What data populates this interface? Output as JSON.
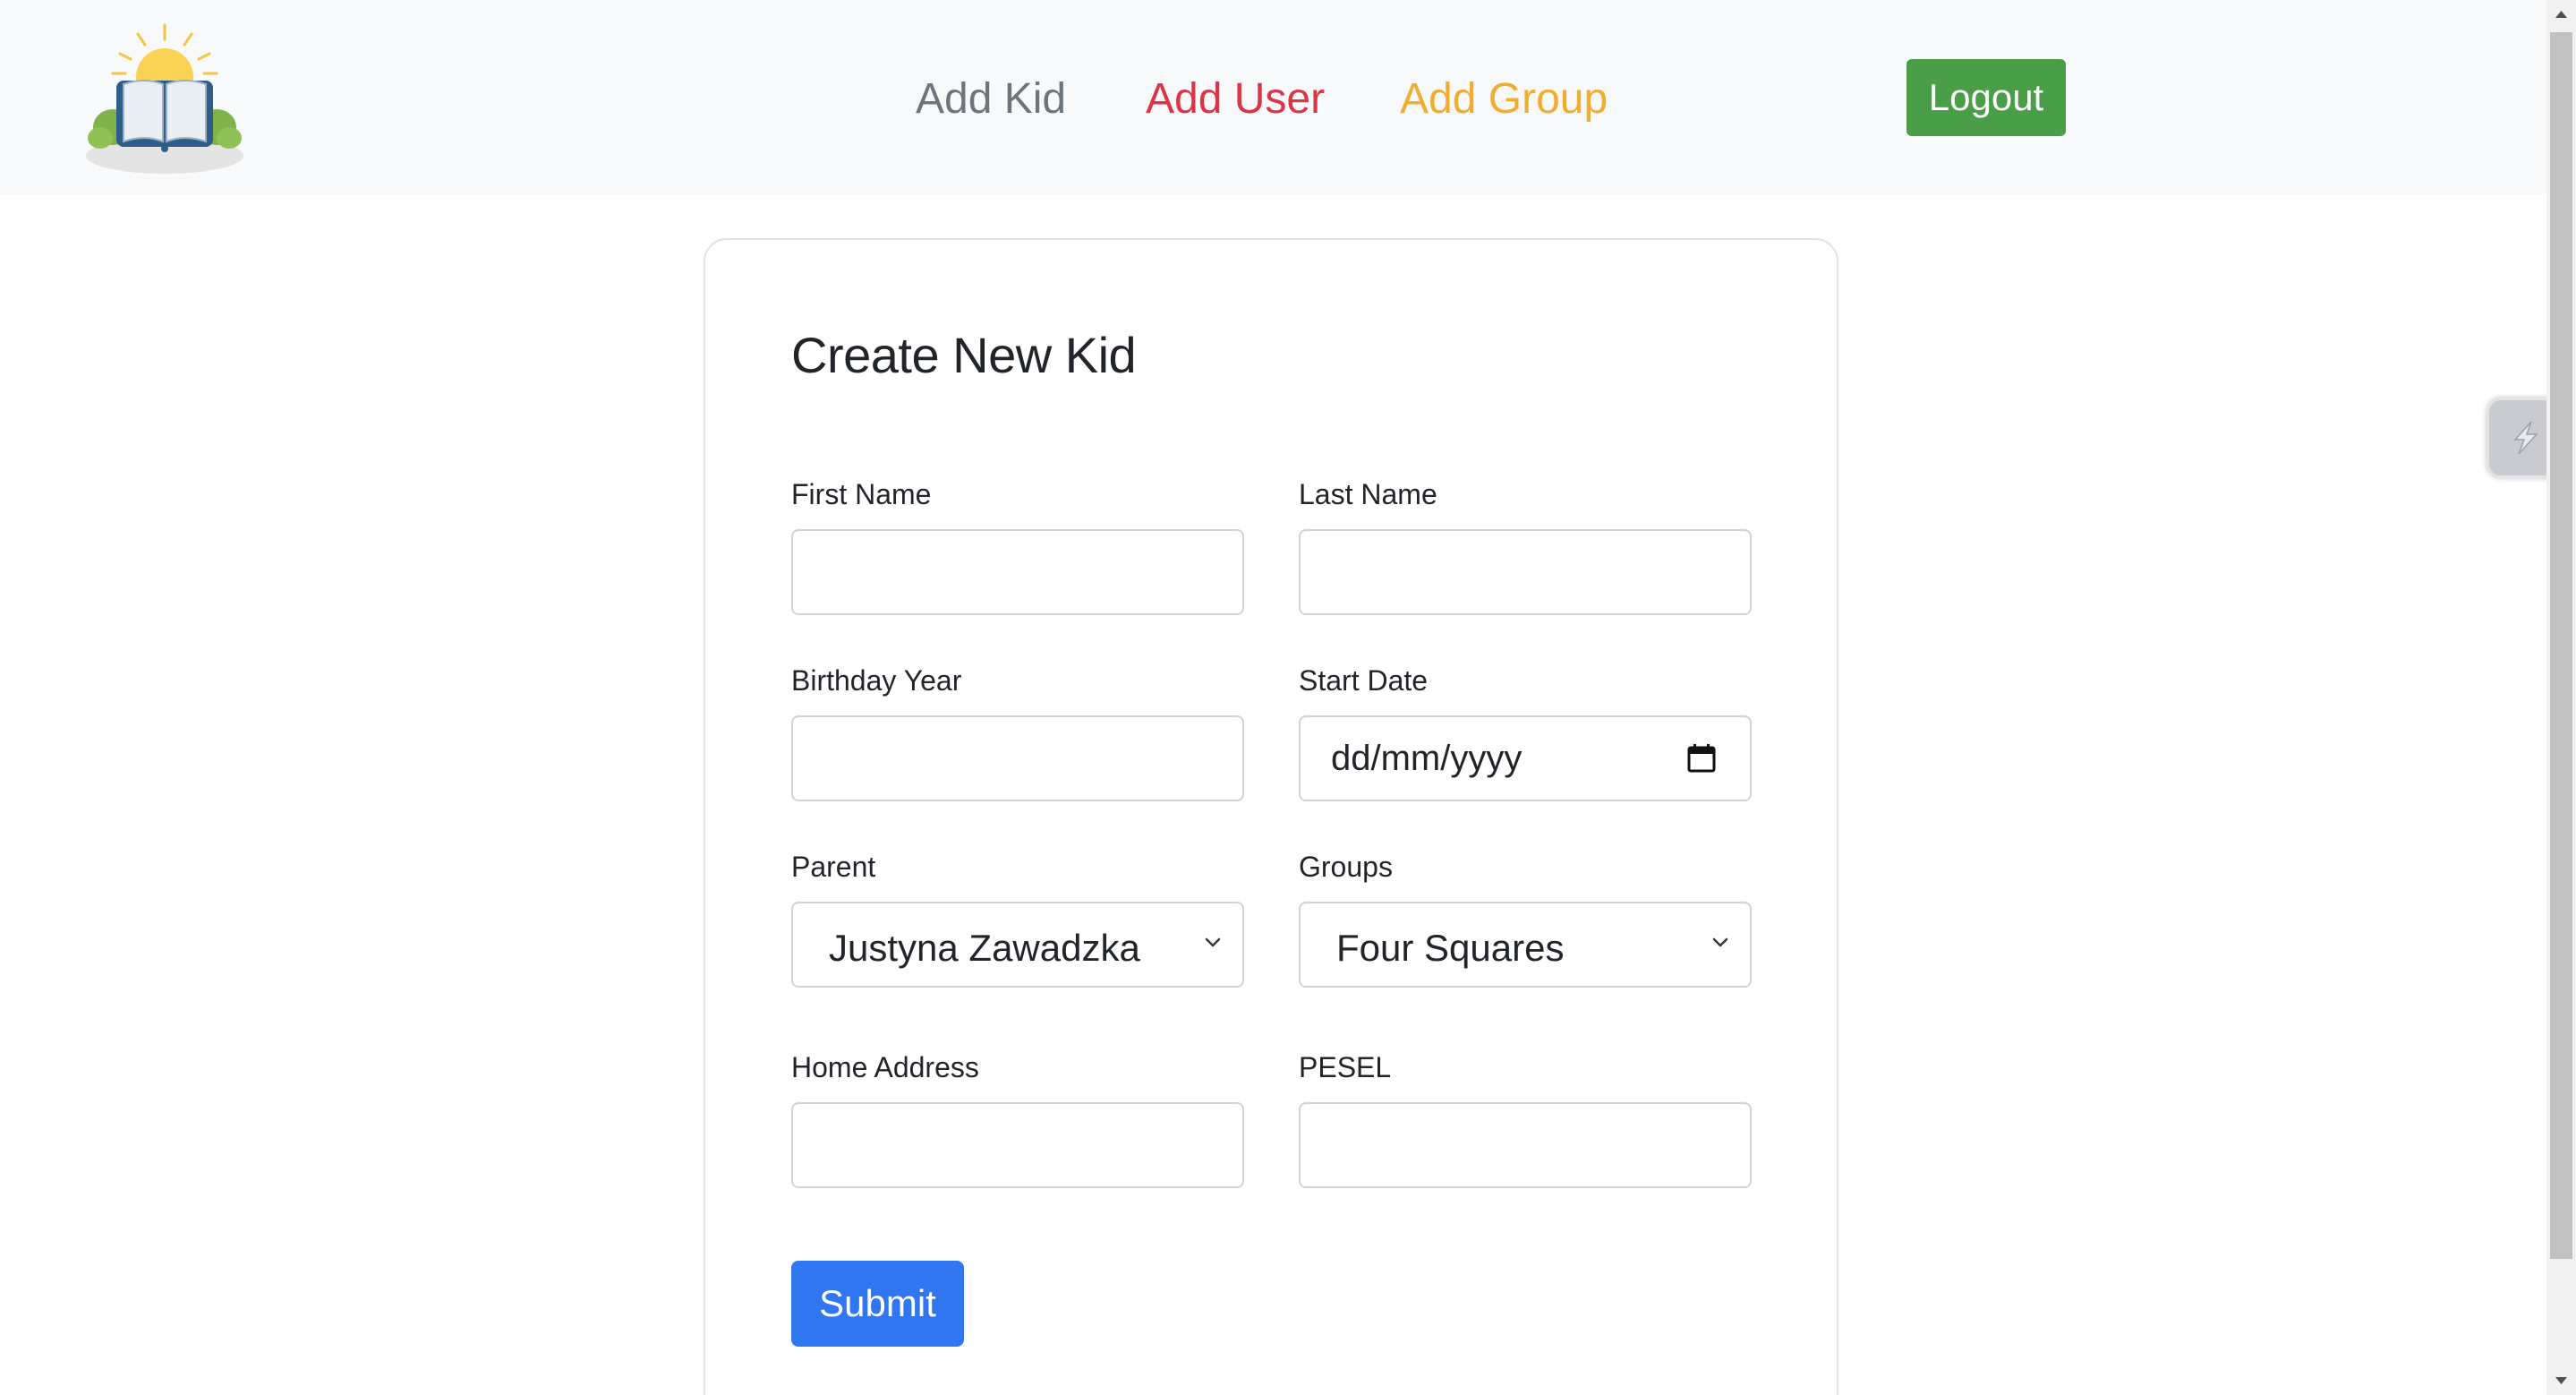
{
  "nav": {
    "logo_icon": "book-sun-logo-icon",
    "links": [
      {
        "label": "Add Kid",
        "color": "#6c757d"
      },
      {
        "label": "Add User",
        "color": "#dc3545"
      },
      {
        "label": "Add Group",
        "color": "#f0ad30"
      }
    ],
    "logout_label": "Logout"
  },
  "form": {
    "title": "Create New Kid",
    "first_name": {
      "label": "First Name",
      "value": ""
    },
    "last_name": {
      "label": "Last Name",
      "value": ""
    },
    "birthday_year": {
      "label": "Birthday Year",
      "value": ""
    },
    "start_date": {
      "label": "Start Date",
      "placeholder": "dd/mm/yyyy",
      "icon": "calendar-icon"
    },
    "parent": {
      "label": "Parent",
      "selected": "Justyna Zawadzka"
    },
    "groups": {
      "label": "Groups",
      "selected": "Four Squares"
    },
    "home_address": {
      "label": "Home Address",
      "value": ""
    },
    "pesel": {
      "label": "PESEL",
      "value": ""
    },
    "submit_label": "Submit"
  },
  "colors": {
    "navbar_bg": "#f8f9fa",
    "logout_bg": "#4a9e48",
    "submit_bg": "#2f76f0"
  }
}
